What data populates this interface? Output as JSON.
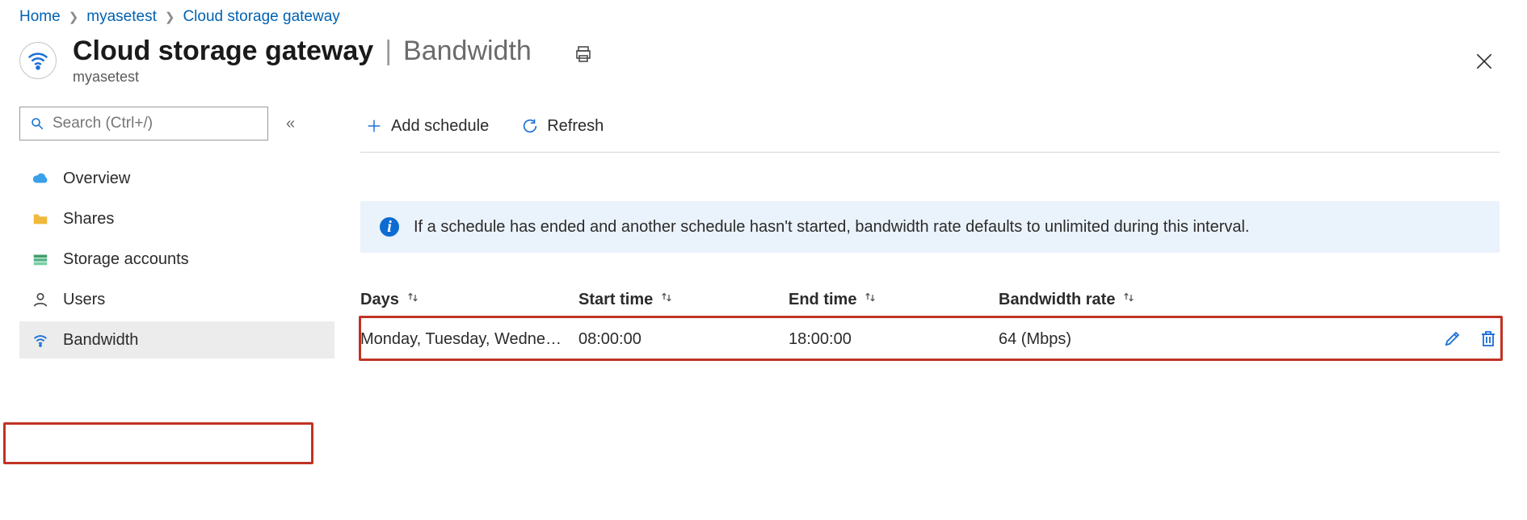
{
  "breadcrumbs": [
    {
      "label": "Home"
    },
    {
      "label": "myasetest"
    },
    {
      "label": "Cloud storage gateway"
    }
  ],
  "header": {
    "title": "Cloud storage gateway",
    "section": "Bandwidth",
    "subtitle": "myasetest"
  },
  "search": {
    "placeholder": "Search (Ctrl+/)"
  },
  "sidebar": {
    "items": [
      {
        "label": "Overview",
        "icon": "cloud-icon"
      },
      {
        "label": "Shares",
        "icon": "folder-icon"
      },
      {
        "label": "Storage accounts",
        "icon": "storage-icon"
      },
      {
        "label": "Users",
        "icon": "person-icon"
      },
      {
        "label": "Bandwidth",
        "icon": "wifi-icon",
        "selected": true
      }
    ]
  },
  "toolbar": {
    "add_label": "Add schedule",
    "refresh_label": "Refresh"
  },
  "info_text": "If a schedule has ended and another schedule hasn't started, bandwidth rate defaults to unlimited during this interval.",
  "table": {
    "columns": [
      "Days",
      "Start time",
      "End time",
      "Bandwidth rate"
    ],
    "rows": [
      {
        "days": "Monday, Tuesday, Wednesd…",
        "start": "08:00:00",
        "end": "18:00:00",
        "rate": "64 (Mbps)"
      }
    ]
  }
}
